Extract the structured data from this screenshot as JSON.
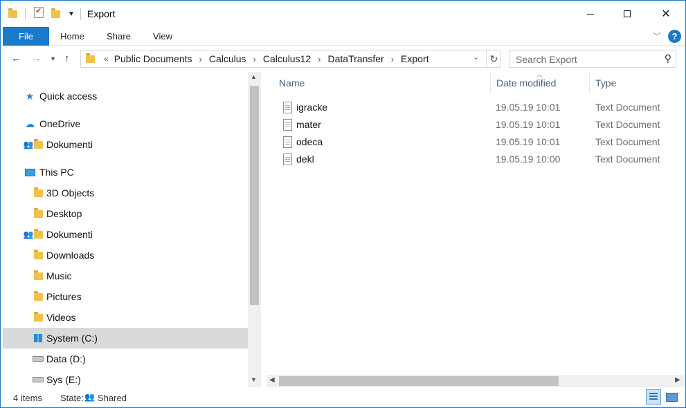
{
  "window": {
    "title": "Export"
  },
  "titlebar": {
    "quick_access_icons": [
      "folder-icon",
      "properties-icon",
      "new-folder-icon",
      "customize-dropdown-icon"
    ],
    "controls": [
      "minimize",
      "maximize",
      "close"
    ]
  },
  "ribbon": {
    "tabs": [
      {
        "label": "File",
        "active": true
      },
      {
        "label": "Home"
      },
      {
        "label": "Share"
      },
      {
        "label": "View"
      }
    ],
    "accent": "#1979ca"
  },
  "address": {
    "overflow": "«",
    "crumbs": [
      "Public Documents",
      "Calculus",
      "Calculus12",
      "DataTransfer",
      "Export"
    ],
    "separator": "›"
  },
  "search": {
    "placeholder": "Search Export"
  },
  "navpane": {
    "items": [
      {
        "label": "Quick access",
        "icon": "star-icon"
      },
      {
        "label": "OneDrive",
        "icon": "cloud-icon"
      },
      {
        "label": "Dokumenti",
        "icon": "shared-folder-icon"
      },
      {
        "label": "This PC",
        "icon": "pc-icon"
      },
      {
        "label": "3D Objects",
        "icon": "folder-icon"
      },
      {
        "label": "Desktop",
        "icon": "folder-icon"
      },
      {
        "label": "Dokumenti",
        "icon": "shared-folder-icon"
      },
      {
        "label": "Downloads",
        "icon": "folder-icon"
      },
      {
        "label": "Music",
        "icon": "folder-icon"
      },
      {
        "label": "Pictures",
        "icon": "folder-icon"
      },
      {
        "label": "Videos",
        "icon": "folder-icon"
      },
      {
        "label": "System (C:)",
        "icon": "windows-drive-icon",
        "selected": true
      },
      {
        "label": "Data (D:)",
        "icon": "drive-icon"
      },
      {
        "label": "Sys (E:)",
        "icon": "drive-icon"
      }
    ]
  },
  "columns": {
    "name": "Name",
    "date": "Date modified",
    "type": "Type"
  },
  "files": [
    {
      "name": "igracke",
      "date": "19.05.19 10:01",
      "type": "Text Document"
    },
    {
      "name": "mater",
      "date": "19.05.19 10:01",
      "type": "Text Document"
    },
    {
      "name": "odeca",
      "date": "19.05.19 10:01",
      "type": "Text Document"
    },
    {
      "name": "dekl",
      "date": "19.05.19 10:00",
      "type": "Text Document"
    }
  ],
  "status": {
    "count": "4 items",
    "state_label": "State:",
    "state_value": "Shared"
  }
}
